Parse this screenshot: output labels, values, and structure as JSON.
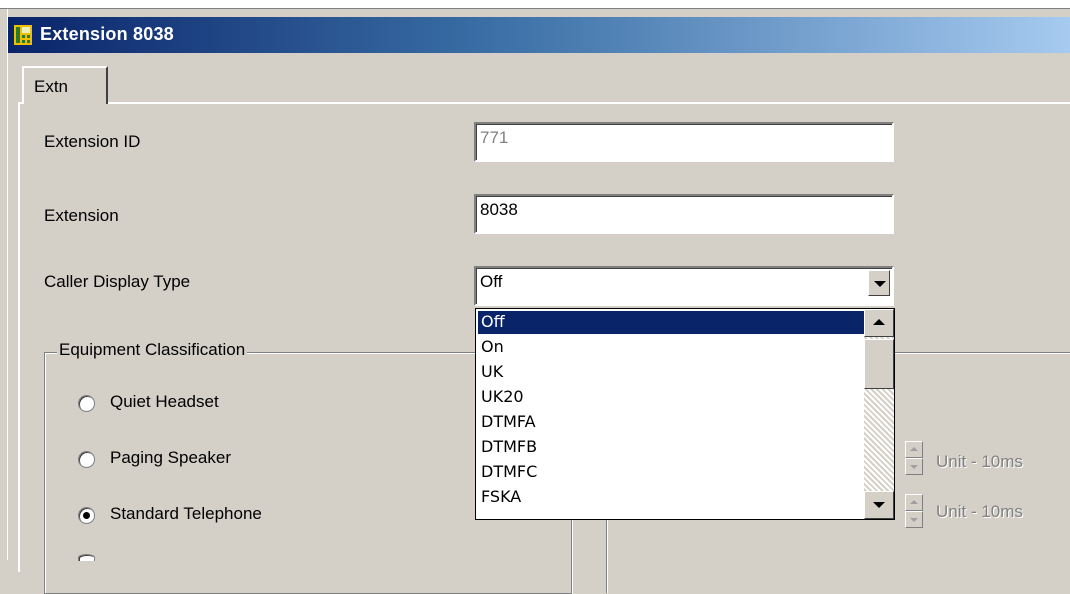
{
  "window": {
    "title": "Extension 8038",
    "icon": "phone-app-icon"
  },
  "tabs": [
    {
      "label": "Extn"
    }
  ],
  "form": {
    "extension_id": {
      "label": "Extension ID",
      "value": "771"
    },
    "extension": {
      "label": "Extension",
      "value": "8038"
    },
    "caller_display_type": {
      "label": "Caller Display Type",
      "value": "Off",
      "options": [
        "Off",
        "On",
        "UK",
        "UK20",
        "DTMFA",
        "DTMFB",
        "DTMFC",
        "FSKA"
      ]
    }
  },
  "equipment_classification": {
    "legend": "Equipment Classification",
    "options": [
      {
        "label": "Quiet Headset",
        "checked": false
      },
      {
        "label": "Paging Speaker",
        "checked": false
      },
      {
        "label": "Standard Telephone",
        "checked": true
      }
    ]
  },
  "timers": {
    "unit_label_1": "Unit - 10ms",
    "unit_label_2": "Unit - 10ms"
  },
  "colors": {
    "titlebar_start": "#0a246a",
    "titlebar_end": "#a6caf0",
    "selection": "#0a246a",
    "face": "#d4d0c8"
  }
}
